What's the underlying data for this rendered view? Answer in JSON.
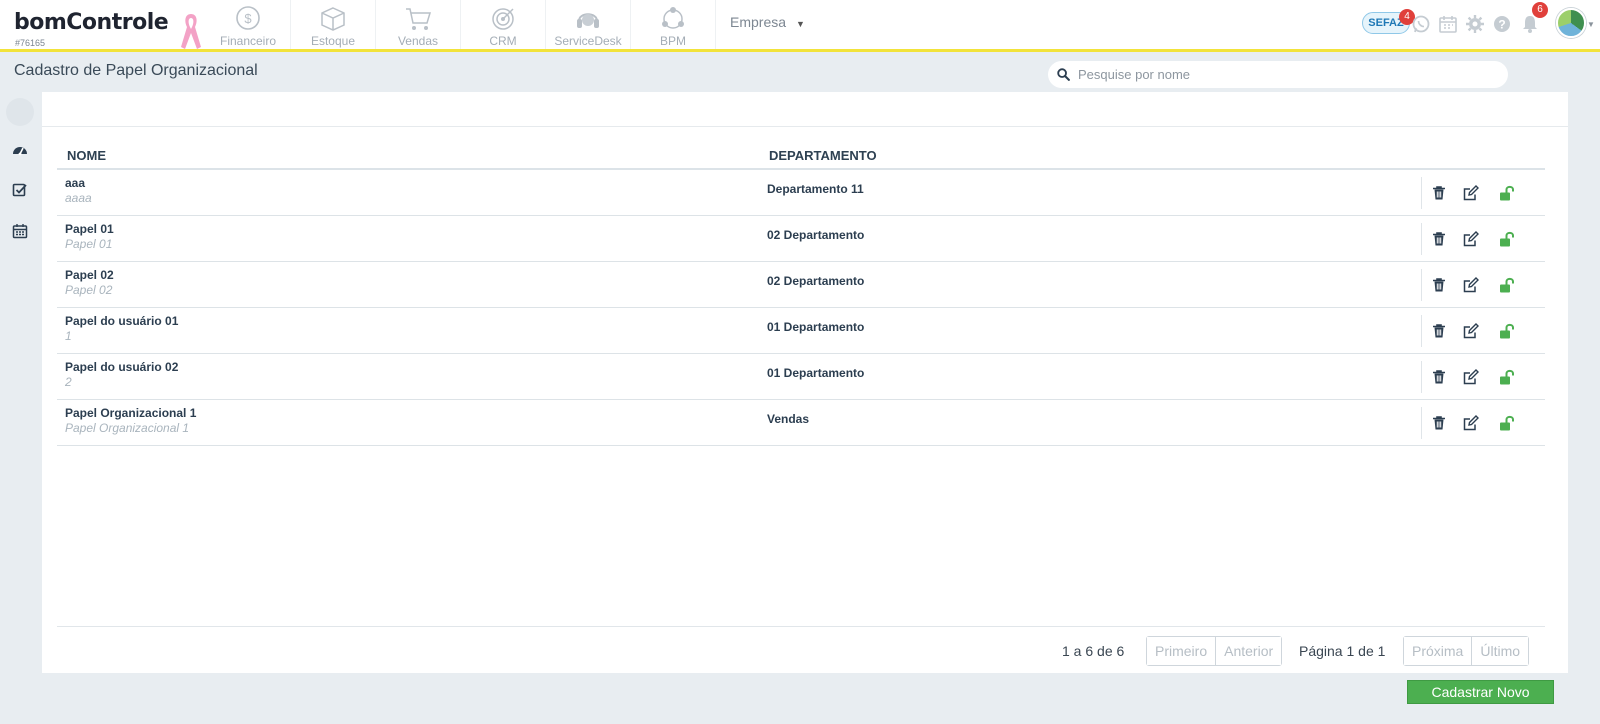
{
  "header": {
    "logo_text": "bomControle",
    "account_id": "#76165",
    "modules": [
      {
        "label": "Financeiro",
        "icon": "money-icon"
      },
      {
        "label": "Estoque",
        "icon": "box-icon"
      },
      {
        "label": "Vendas",
        "icon": "cart-icon"
      },
      {
        "label": "CRM",
        "icon": "target-icon"
      },
      {
        "label": "ServiceDesk",
        "icon": "headset-icon"
      },
      {
        "label": "BPM",
        "icon": "process-icon"
      }
    ],
    "company_menu": "Empresa",
    "sefaz_label": "SEFAZ",
    "sefaz_badge": "4",
    "notifications_badge": "6"
  },
  "page": {
    "title": "Cadastro de Papel Organizacional",
    "search_placeholder": "Pesquise por nome"
  },
  "table": {
    "columns": [
      "NOME",
      "DEPARTAMENTO"
    ],
    "rows": [
      {
        "name": "aaa",
        "description": "aaaa",
        "department": "Departamento 11"
      },
      {
        "name": "Papel 01",
        "description": "Papel 01",
        "department": "02 Departamento"
      },
      {
        "name": "Papel 02",
        "description": "Papel 02",
        "department": "02 Departamento"
      },
      {
        "name": "Papel do usuário 01",
        "description": "1",
        "department": "01 Departamento"
      },
      {
        "name": "Papel do usuário 02",
        "description": "2",
        "department": "01 Departamento"
      },
      {
        "name": "Papel Organizacional 1",
        "description": "Papel Organizacional 1",
        "department": "Vendas"
      }
    ]
  },
  "pagination": {
    "count_text": "1 a 6 de 6",
    "first": "Primeiro",
    "prev": "Anterior",
    "page_text": "Página 1 de 1",
    "next": "Próxima",
    "last": "Último"
  },
  "actions": {
    "new_label": "Cadastrar Novo"
  },
  "colors": {
    "accent_yellow": "#f2e33a",
    "primary_green": "#4caf50",
    "badge_red": "#e0403b"
  }
}
